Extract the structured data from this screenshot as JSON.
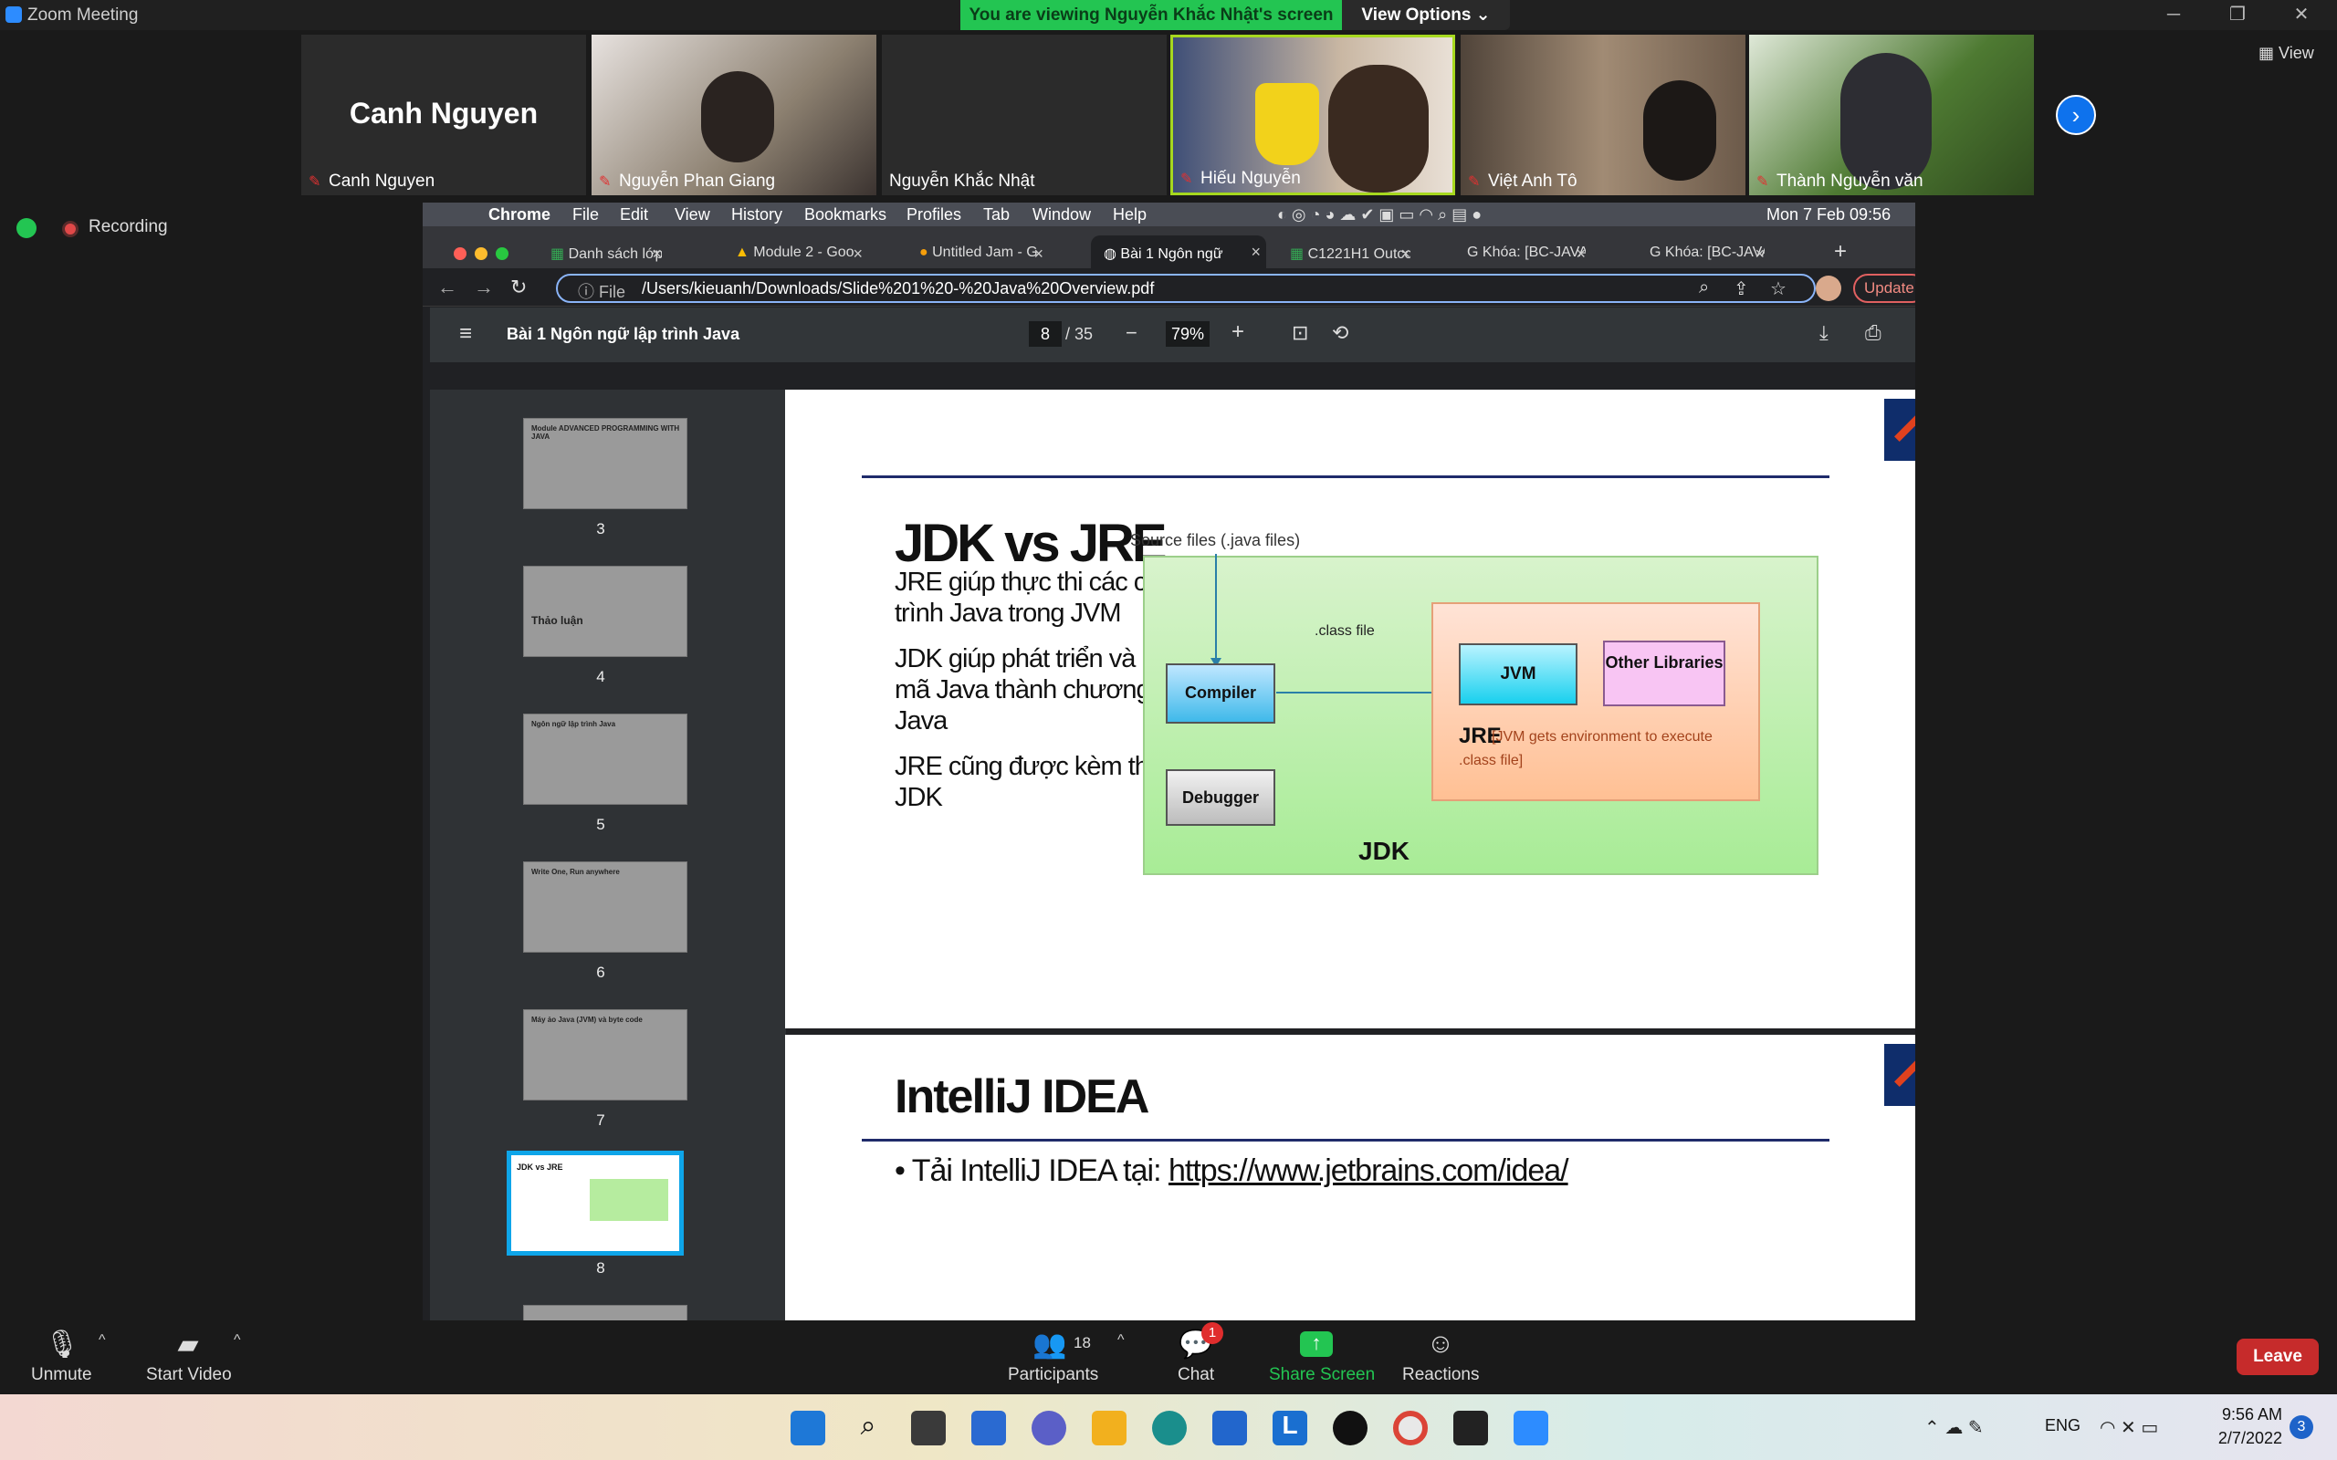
{
  "zoom": {
    "window_title": "Zoom Meeting",
    "viewing_banner": "You are viewing Nguyễn Khắc Nhật's screen",
    "view_options": "View Options ⌄",
    "view_button": "View",
    "recording": "Recording",
    "participants": [
      {
        "name": "Canh Nguyen",
        "big_name": "Canh Nguyen"
      },
      {
        "name": "Nguyễn Phan Giang"
      },
      {
        "name": "Nguyễn Khắc Nhật"
      },
      {
        "name": "Hiếu Nguyễn"
      },
      {
        "name": "Việt Anh Tô"
      },
      {
        "name": "Thành Nguyễn văn"
      }
    ],
    "toolbar": {
      "unmute": "Unmute",
      "start_video": "Start Video",
      "participants": "Participants",
      "participant_count": "18",
      "chat": "Chat",
      "chat_badge": "1",
      "share_screen": "Share Screen",
      "reactions": "Reactions",
      "leave": "Leave"
    }
  },
  "mac": {
    "app": "Chrome",
    "menus": [
      "File",
      "Edit",
      "View",
      "History",
      "Bookmarks",
      "Profiles",
      "Tab",
      "Window",
      "Help"
    ],
    "clock": "Mon 7 Feb  09:56"
  },
  "chrome": {
    "tabs": [
      "Danh sách lớp -",
      "Module 2 - Goo",
      "Untitled Jam - G",
      "Bài 1 Ngôn ngữ",
      "C1221H1 Outco",
      "Khóa: [BC-JAVA",
      "Khóa: [BC-JAVA"
    ],
    "file_chip": "File",
    "url": "/Users/kieuanh/Downloads/Slide%201%20-%20Java%20Overview.pdf",
    "update": "Update"
  },
  "pdf": {
    "title": "Bài 1 Ngôn ngữ lập trình Java",
    "page_current": "8",
    "page_total": "/ 35",
    "zoom": "79%",
    "thumbs": [
      {
        "num": "3",
        "label": "Module ADVANCED PROGRAMMING WITH JAVA"
      },
      {
        "num": "4",
        "label": "Thảo luận"
      },
      {
        "num": "5",
        "label": "Ngôn ngữ lập trình Java"
      },
      {
        "num": "6",
        "label": "Write One, Run anywhere"
      },
      {
        "num": "7",
        "label": "Máy ảo Java (JVM) và byte code"
      },
      {
        "num": "8",
        "label": "JDK vs JRE"
      }
    ],
    "slide8": {
      "title": "JDK vs JRE",
      "bullets": [
        "JRE giúp thực thi các chương trình Java trong JVM",
        "JDK giúp phát triển và biên dịch mã Java thành chương trình Java",
        "JRE cũng được kèm theo trong JDK"
      ],
      "diagram": {
        "source": "Source files (.java files)",
        "compiler": "Compiler",
        "class_file": ".class file",
        "jvm": "JVM",
        "other_libs": "Other Libraries",
        "jre": "JRE",
        "jre_desc": "[JVM gets environment  to execute",
        "jre_desc2": ".class file]",
        "debugger": "Debugger",
        "jdk": "JDK"
      }
    },
    "slide9": {
      "title": "IntelliJ IDEA",
      "text": "• Tải IntelliJ IDEA tại: ",
      "link": "https://www.jetbrains.com/idea/"
    }
  },
  "taskbar": {
    "lang": "ENG",
    "time": "9:56 AM",
    "date": "2/7/2022",
    "notifications": "3"
  }
}
